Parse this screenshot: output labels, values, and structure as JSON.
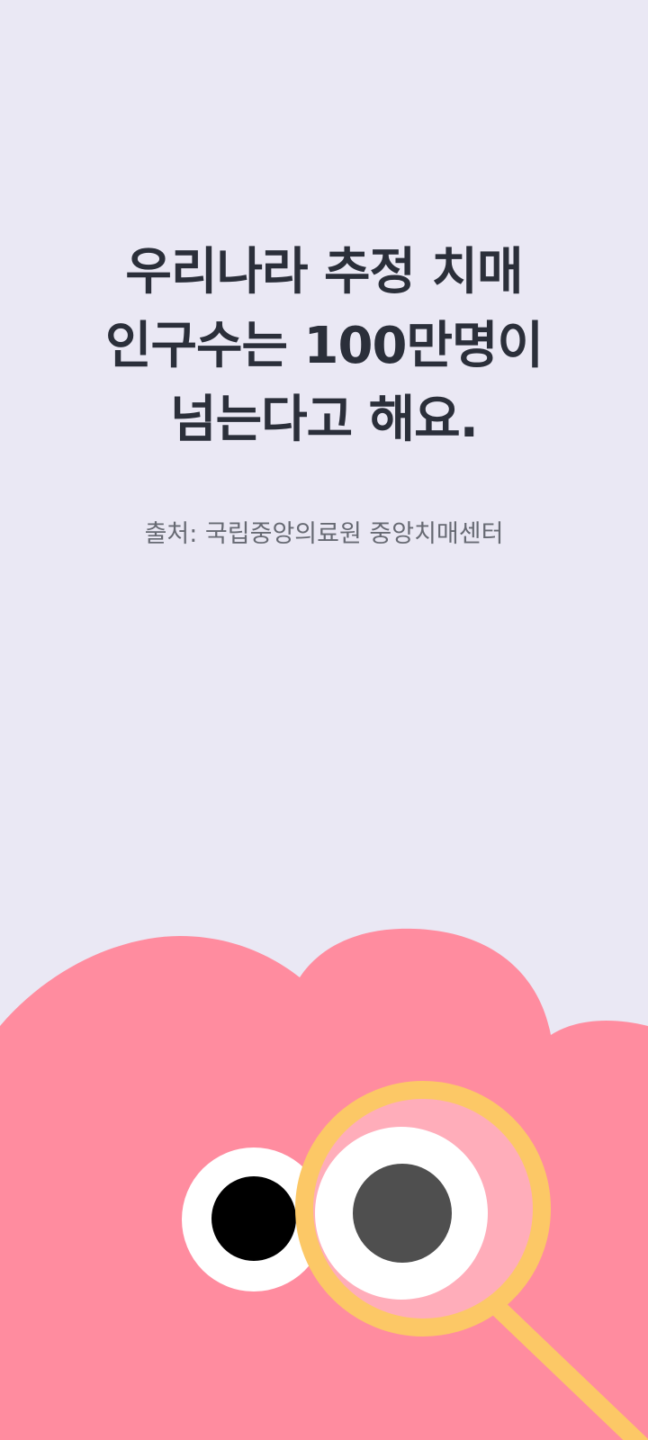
{
  "headline": {
    "line1": "우리나라 추정 치매",
    "line2": "인구수는 100만명이",
    "line3": "넘는다고 해요."
  },
  "source": {
    "text": "출처: 국립중앙의료원 중앙치매센터"
  },
  "colors": {
    "background": "#eae8f4",
    "headline_text": "#2b2f3a",
    "source_text": "#676a73",
    "mascot_body": "#ff8c9f",
    "magnifier_ring": "#fcc866",
    "magnifier_lens": "#ffadba",
    "eye_white": "#ffffff",
    "pupil_left": "#000000",
    "pupil_right": "#4f4f4f"
  },
  "illustration": {
    "name": "pink-cloud-mascot-with-magnifying-glass"
  }
}
